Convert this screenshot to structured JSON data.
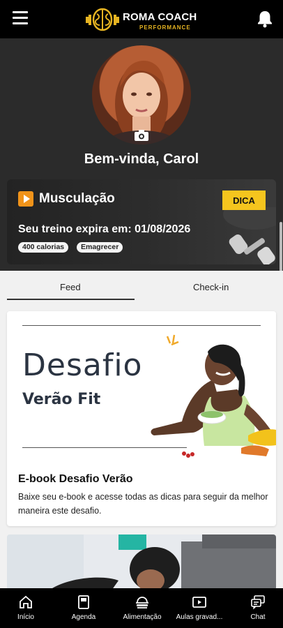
{
  "header": {
    "logo_title": "ROMA COACH",
    "logo_subtitle": "PERFORMANCE",
    "menu_icon": "hamburger-menu-icon",
    "notification_icon": "bell-icon"
  },
  "profile": {
    "welcome": "Bem-vinda, Carol",
    "camera_icon": "camera-icon"
  },
  "banner": {
    "icon": "play-icon",
    "title": "Musculação",
    "tip_button": "DICA",
    "expiry_text": "Seu treino expira em: 01/08/2026",
    "tags": [
      "400 calorias",
      "Emagrecer"
    ]
  },
  "tabs": [
    {
      "label": "Feed",
      "active": true
    },
    {
      "label": "Check-in",
      "active": false
    }
  ],
  "feed": {
    "post1": {
      "image_heading": "Desafio",
      "image_subheading": "Verão Fit",
      "title": "E-book Desafio Verão",
      "description": "Baixe seu e-book e acesse todas as dicas para seguir da melhor maneira este desafio."
    }
  },
  "bottom_nav": [
    {
      "label": "Início",
      "icon": "home-icon"
    },
    {
      "label": "Agenda",
      "icon": "agenda-icon"
    },
    {
      "label": "Alimentação",
      "icon": "food-icon"
    },
    {
      "label": "Aulas gravad...",
      "icon": "video-icon"
    },
    {
      "label": "Chat",
      "icon": "chat-icon"
    }
  ],
  "colors": {
    "accent": "#f5c51e",
    "topbar": "#000000",
    "profile_bg": "#2b2b2b",
    "play_orange": "#f0931a"
  }
}
